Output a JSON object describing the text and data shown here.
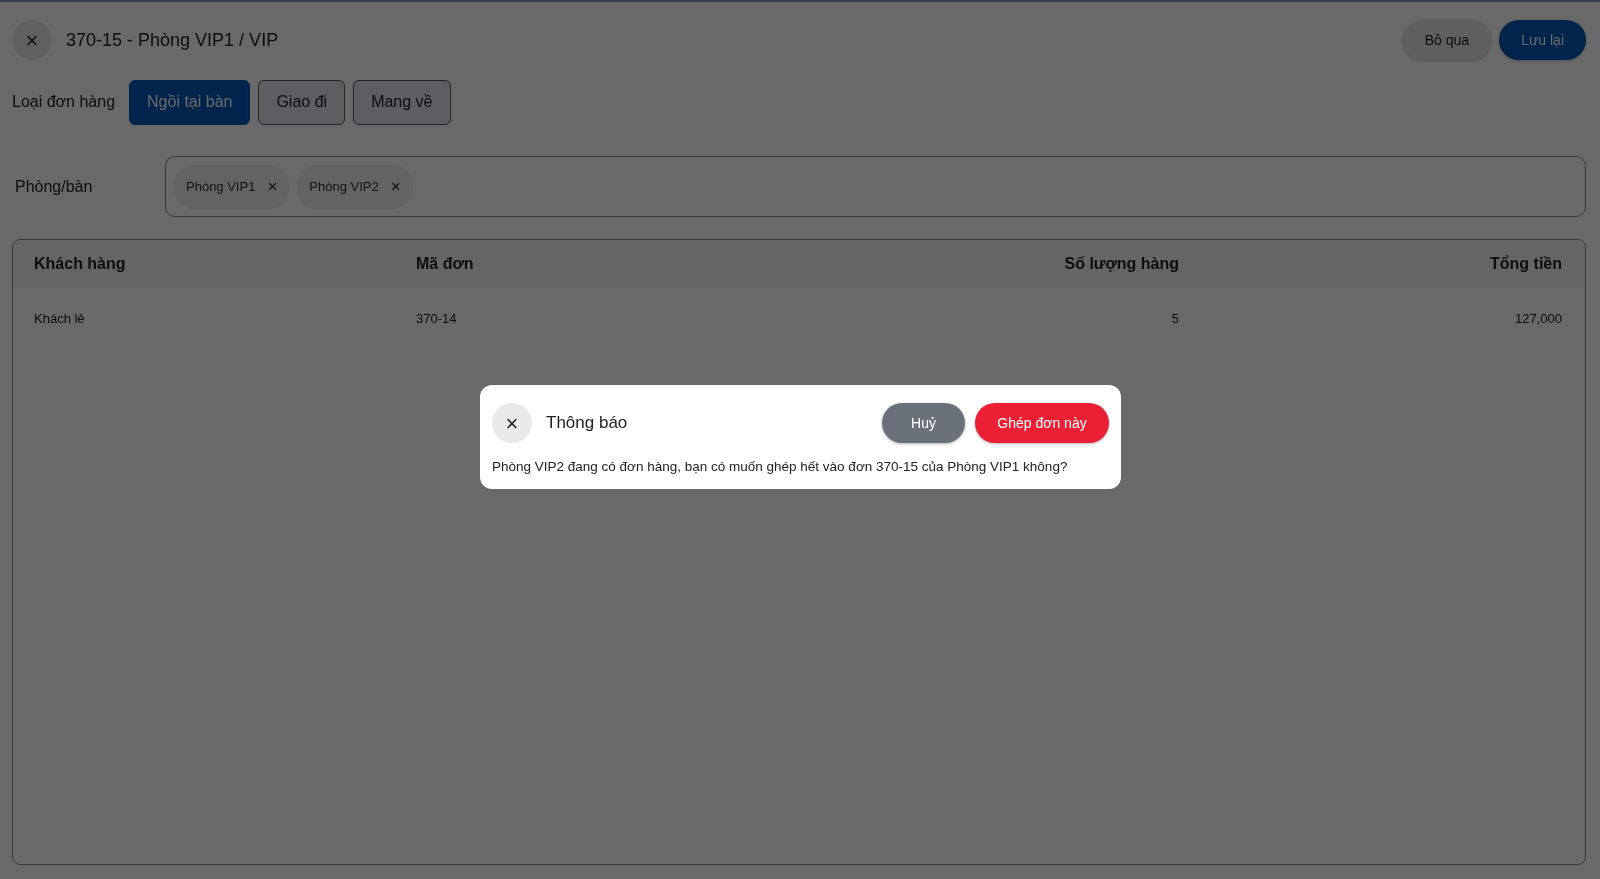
{
  "header": {
    "close_symbol": "×",
    "title": "370-15 - Phòng VIP1 / VIP",
    "actions": [
      {
        "label": "Bỏ qua",
        "kind": "secondary"
      },
      {
        "label": "Lưu lại",
        "kind": "primary"
      }
    ]
  },
  "order_type": {
    "label": "Loại đơn hàng",
    "options": [
      {
        "label": "Ngồi tại bàn",
        "selected": true
      },
      {
        "label": "Giao đi",
        "selected": false
      },
      {
        "label": "Mang về",
        "selected": false
      }
    ]
  },
  "rooms": {
    "label": "Phòng/bàn",
    "chips": [
      {
        "label": "Phòng VIP1",
        "remove_symbol": "×"
      },
      {
        "label": "Phòng VIP2",
        "remove_symbol": "×"
      }
    ]
  },
  "table": {
    "columns": [
      "Khách hàng",
      "Mã đơn",
      "Số lượng hàng",
      "Tổng tiền"
    ],
    "rows": [
      [
        "Khách lẻ",
        "370-14",
        "5",
        "127,000"
      ]
    ]
  },
  "dialog": {
    "close_symbol": "×",
    "title": "Thông báo",
    "buttons": [
      {
        "label": "Huỷ",
        "kind": "cancel"
      },
      {
        "label": "Ghép đơn này",
        "kind": "danger"
      }
    ],
    "message": "Phòng VIP2 đang có đơn hàng, bạn có muốn ghép hết vào đơn 370-15 của Phòng VIP1 không?"
  }
}
